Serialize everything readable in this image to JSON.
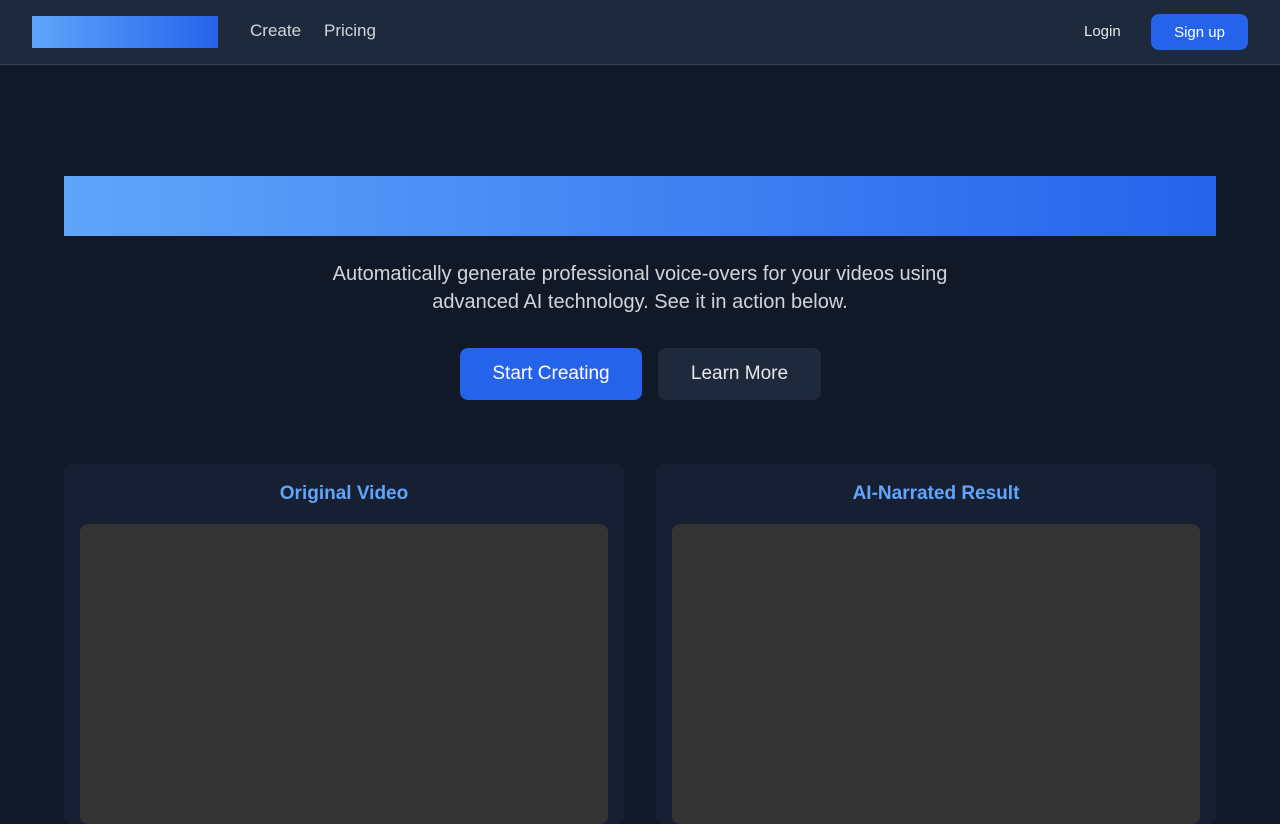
{
  "nav": {
    "links": [
      {
        "label": "Create"
      },
      {
        "label": "Pricing"
      }
    ],
    "login_label": "Login",
    "signup_label": "Sign up"
  },
  "hero": {
    "subtitle": "Automatically generate professional voice-overs for your videos using advanced AI technology. See it in action below.",
    "primary_button": "Start Creating",
    "secondary_button": "Learn More"
  },
  "panels": [
    {
      "title": "Original Video"
    },
    {
      "title": "AI-Narrated Result"
    }
  ],
  "colors": {
    "background": "#111827",
    "navbar": "#1e293b",
    "accent": "#2563eb",
    "accent_light": "#60a5fa",
    "panel": "#172033",
    "video_placeholder": "#333333"
  }
}
